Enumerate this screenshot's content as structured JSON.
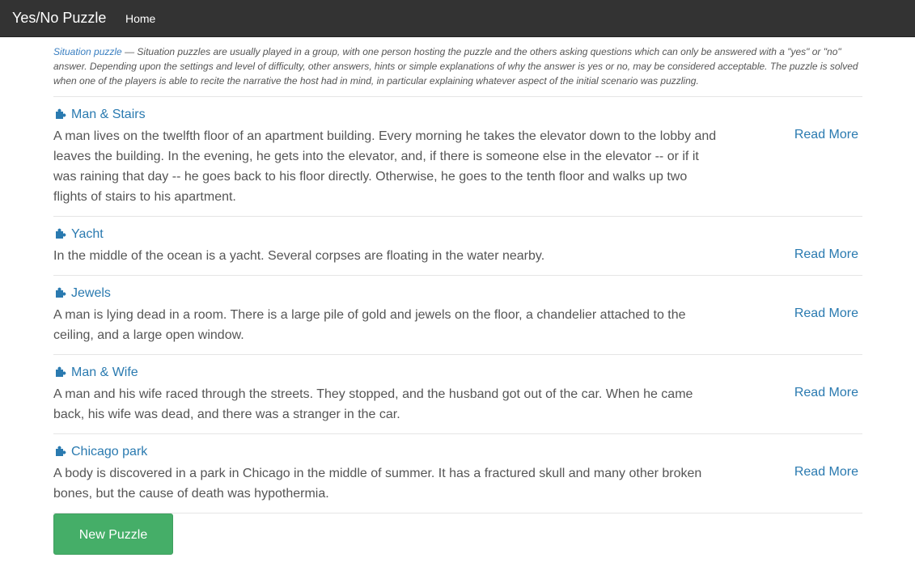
{
  "navbar": {
    "brand": "Yes/No Puzzle",
    "home": "Home"
  },
  "intro": {
    "link_text": "Situation puzzle",
    "text": " — Situation puzzles are usually played in a group, with one person hosting the puzzle and the others asking questions which can only be answered with a \"yes\" or \"no\" answer. Depending upon the settings and level of difficulty, other answers, hints or simple explanations of why the answer is yes or no, may be considered acceptable. The puzzle is solved when one of the players is able to recite the narrative the host had in mind, in particular explaining whatever aspect of the initial scenario was puzzling."
  },
  "puzzles": [
    {
      "title": "Man & Stairs",
      "description": "A man lives on the twelfth floor of an apartment building. Every morning he takes the elevator down to the lobby and leaves the building. In the evening, he gets into the elevator, and, if there is someone else in the elevator -- or if it was raining that day -- he goes back to his floor directly. Otherwise, he goes to the tenth floor and walks up two flights of stairs to his apartment.",
      "read_more": "Read More"
    },
    {
      "title": "Yacht",
      "description": "In the middle of the ocean is a yacht. Several corpses are floating in the water nearby.",
      "read_more": "Read More"
    },
    {
      "title": "Jewels",
      "description": "A man is lying dead in a room. There is a large pile of gold and jewels on the floor, a chandelier attached to the ceiling, and a large open window.",
      "read_more": "Read More"
    },
    {
      "title": "Man & Wife",
      "description": "A man and his wife raced through the streets. They stopped, and the husband got out of the car. When he came back, his wife was dead, and there was a stranger in the car.",
      "read_more": "Read More"
    },
    {
      "title": "Chicago park",
      "description": "A body is discovered in a park in Chicago in the middle of summer. It has a fractured skull and many other broken bones, but the cause of death was hypothermia.",
      "read_more": "Read More"
    }
  ],
  "new_puzzle_button": "New Puzzle",
  "icons": {
    "puzzle": "puzzle-piece-icon"
  },
  "colors": {
    "navbar": "#333333",
    "link": "#2a7ab0",
    "button": "#45ae68",
    "text": "#555555"
  }
}
